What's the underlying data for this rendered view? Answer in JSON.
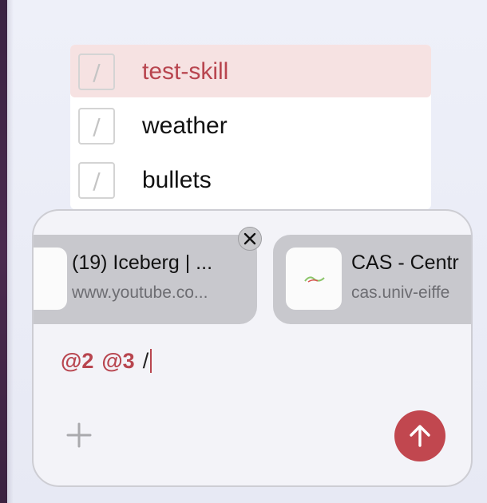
{
  "skill_menu": {
    "items": [
      {
        "icon_glyph": "/",
        "label": "test-skill",
        "selected": true
      },
      {
        "icon_glyph": "/",
        "label": "weather",
        "selected": false
      },
      {
        "icon_glyph": "/",
        "label": "bullets",
        "selected": false
      }
    ]
  },
  "composer": {
    "attachments": [
      {
        "title": "(19) Iceberg | ...",
        "url": "www.youtube.co...",
        "icon": "youtube-icon"
      },
      {
        "title": "CAS - Centr",
        "url": "cas.univ-eiffe",
        "icon": "cas-icon"
      }
    ],
    "mentions": [
      "@2",
      "@3"
    ],
    "typed_text": "/",
    "plus_icon": "plus-icon",
    "send_icon": "arrow-up-icon",
    "close_icon": "close-icon"
  },
  "colors": {
    "accent": "#c1474f",
    "selected_bg": "#f6e2e2",
    "card_bg": "#c8c8cd"
  }
}
